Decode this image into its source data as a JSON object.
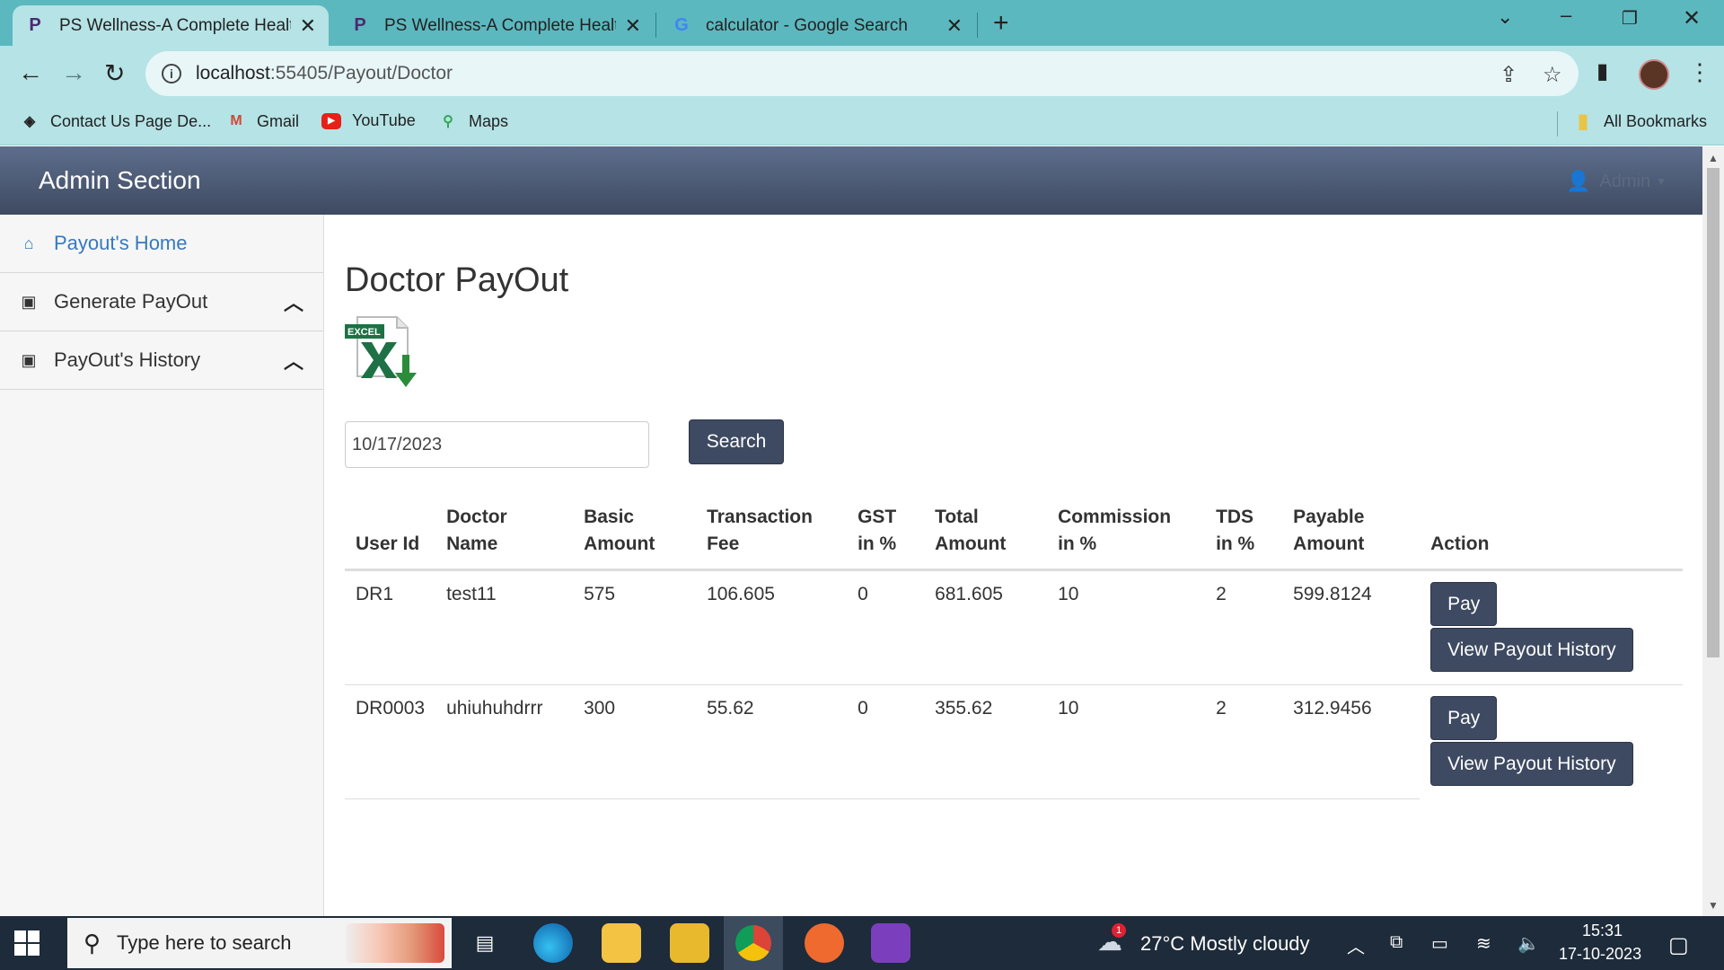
{
  "browser": {
    "tabs": [
      {
        "title": "PS Wellness-A Complete Health",
        "active": true,
        "favicon": "ps-wellness-favicon"
      },
      {
        "title": "PS Wellness-A Complete Health",
        "active": false,
        "favicon": "ps-wellness-favicon"
      },
      {
        "title": "calculator - Google Search",
        "active": false,
        "favicon": "google-favicon"
      }
    ],
    "url_host": "localhost",
    "url_path": ":55405/Payout/Doctor",
    "bookmarks": [
      {
        "label": "Contact Us Page De...",
        "icon": "codepen-icon"
      },
      {
        "label": "Gmail",
        "icon": "gmail-icon"
      },
      {
        "label": "YouTube",
        "icon": "youtube-icon"
      },
      {
        "label": "Maps",
        "icon": "maps-icon"
      }
    ],
    "all_bookmarks": "All Bookmarks"
  },
  "header": {
    "title": "Admin Section",
    "user": "Admin"
  },
  "sidebar": {
    "items": [
      {
        "label": "Payout's Home",
        "icon": "home-icon"
      },
      {
        "label": "Generate PayOut",
        "icon": "money-icon"
      },
      {
        "label": "PayOut's History",
        "icon": "money-icon"
      }
    ]
  },
  "main": {
    "title": "Doctor PayOut",
    "excel_label": "EXCEL",
    "date_value": "10/17/2023",
    "search_label": "Search",
    "table": {
      "headers": {
        "user_id": "User Id",
        "doctor_name_1": "Doctor",
        "doctor_name_2": "Name",
        "basic_1": "Basic",
        "basic_2": "Amount",
        "fee_1": "Transaction",
        "fee_2": "Fee",
        "gst_1": "GST",
        "gst_2": "in %",
        "total_1": "Total",
        "total_2": "Amount",
        "comm_1": "Commission",
        "comm_2": "in %",
        "tds_1": "TDS",
        "tds_2": "in %",
        "payable_1": "Payable",
        "payable_2": "Amount",
        "action": "Action"
      },
      "rows": [
        {
          "user_id": "DR1",
          "doctor_name": "test11",
          "basic_amount": "575",
          "transaction_fee": "106.605",
          "gst": "0",
          "total_amount": "681.605",
          "commission": "10",
          "tds": "2",
          "payable_amount": "599.8124",
          "pay_label": "Pay",
          "history_label": "View Payout History"
        },
        {
          "user_id": "DR0003",
          "doctor_name": "uhiuhuhdrrr",
          "basic_amount": "300",
          "transaction_fee": "55.62",
          "gst": "0",
          "total_amount": "355.62",
          "commission": "10",
          "tds": "2",
          "payable_amount": "312.9456",
          "pay_label": "Pay",
          "history_label": "View Payout History"
        }
      ]
    }
  },
  "taskbar": {
    "search_placeholder": "Type here to search",
    "weather": "27°C  Mostly cloudy",
    "weather_badge": "1",
    "time": "15:31",
    "date": "17-10-2023"
  },
  "colors": {
    "tabbar": "#5cb8bf",
    "toolbar": "#b5e3e6",
    "admin_bar": "#4a566e",
    "button": "#3e4a61",
    "link": "#3579c0"
  }
}
